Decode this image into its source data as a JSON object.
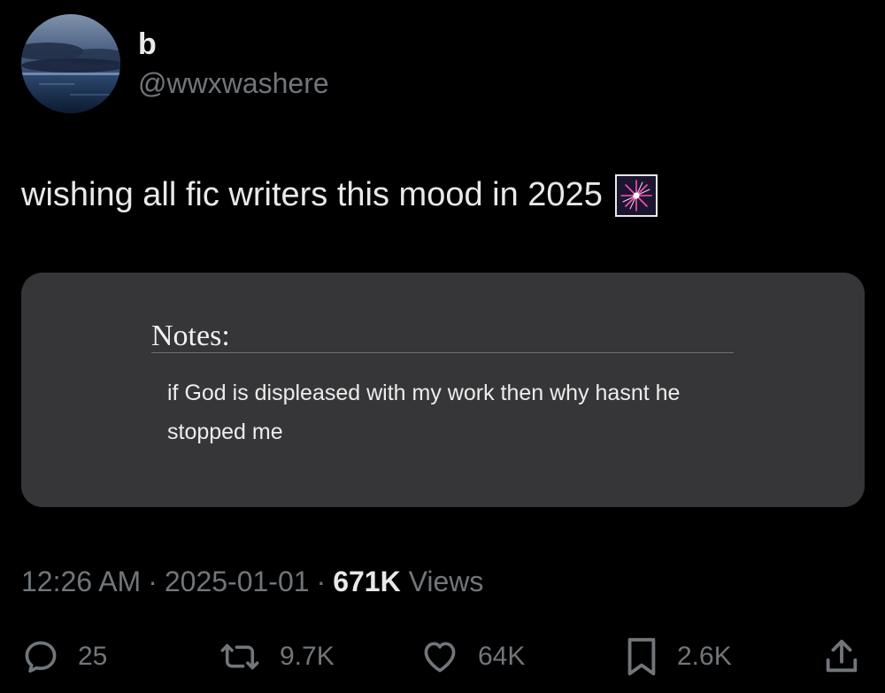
{
  "author": {
    "display_name": "b",
    "handle": "@wwxwashere",
    "avatar_icon": "ocean-dusk-avatar"
  },
  "tweet": {
    "text": "wishing all fic writers this mood in 2025",
    "emoji_icon": "fireworks-emoji"
  },
  "media": {
    "notes_title": "Notes:",
    "notes_body": "if God is displeased with my work then why hasnt he stopped me"
  },
  "meta": {
    "time": "12:26 AM",
    "separator": "·",
    "date": "2025-01-01",
    "views_count": "671K",
    "views_label": "Views"
  },
  "actions": {
    "reply": {
      "icon": "reply-icon",
      "count": "25"
    },
    "retweet": {
      "icon": "retweet-icon",
      "count": "9.7K"
    },
    "like": {
      "icon": "heart-icon",
      "count": "64K"
    },
    "bookmark": {
      "icon": "bookmark-icon",
      "count": "2.6K"
    },
    "share": {
      "icon": "share-icon"
    }
  },
  "colors": {
    "background": "#000000",
    "primary_text": "#e7e9ea",
    "secondary_text": "#71767b",
    "card_background": "#363638"
  }
}
